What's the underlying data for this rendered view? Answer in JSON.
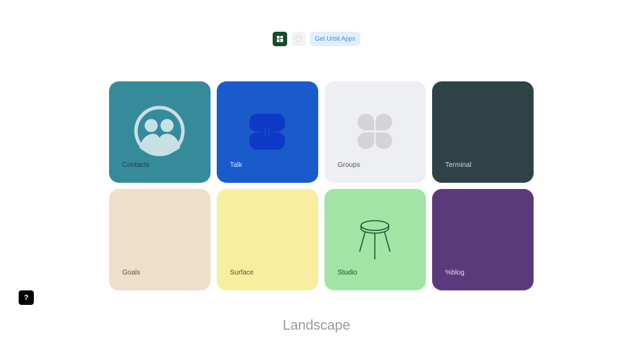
{
  "topbar": {
    "home_icon": "urbit-logo-icon",
    "notifications_icon": "notification-dot-icon",
    "get_apps_label": "Get Urbit Apps"
  },
  "tiles": [
    {
      "label": "Contacts",
      "bg": "#368b9b",
      "fg": "#1f3d45",
      "icon": "contacts-icon"
    },
    {
      "label": "Talk",
      "bg": "#1a5bcc",
      "fg": "#cfe0ff",
      "icon": "talk-icon"
    },
    {
      "label": "Groups",
      "bg": "#eeeff3",
      "fg": "#555555",
      "icon": "groups-icon"
    },
    {
      "label": "Terminal",
      "bg": "#2f4347",
      "fg": "#cfd7d8",
      "icon": ""
    },
    {
      "label": "Goals",
      "bg": "#eedfc9",
      "fg": "#5a5147",
      "icon": ""
    },
    {
      "label": "Surface",
      "bg": "#f7eea0",
      "fg": "#5a5427",
      "icon": ""
    },
    {
      "label": "Studio",
      "bg": "#a1e4a6",
      "fg": "#1f4a27",
      "icon": "stool-icon"
    },
    {
      "label": "%blog",
      "bg": "#5a3a7b",
      "fg": "#e2d7ef",
      "icon": ""
    }
  ],
  "help": {
    "label": "?"
  },
  "footer": {
    "title": "Landscape"
  }
}
